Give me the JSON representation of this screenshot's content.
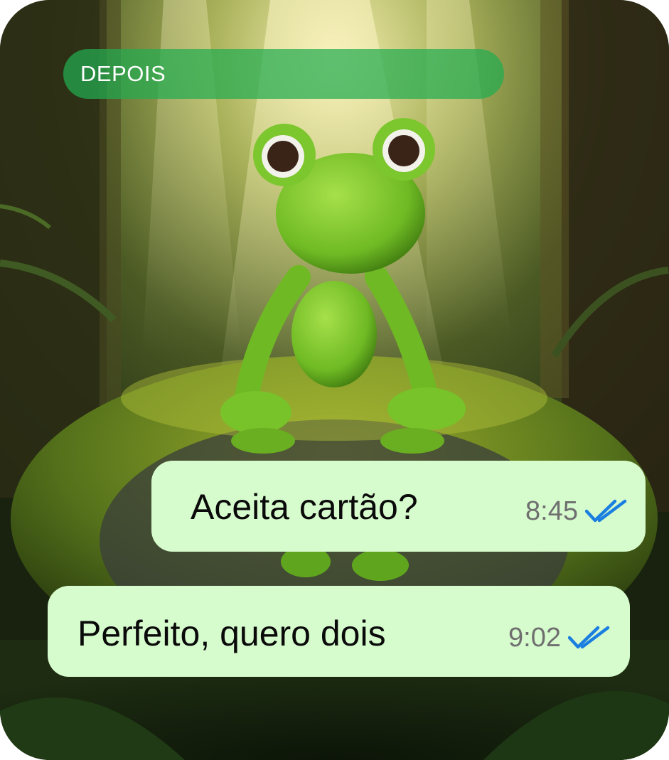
{
  "label": "DEPOIS",
  "messages": [
    {
      "text": "Aceita cartão?",
      "time": "8:45",
      "status_icon": "double-check-icon"
    },
    {
      "text": "Perfeito, quero dois",
      "time": "9:02",
      "status_icon": "double-check-icon"
    }
  ],
  "colors": {
    "banner": "#22ac50",
    "bubble": "#d6fbcd",
    "tick": "#1a7fe0",
    "time": "#6f6f6f"
  }
}
